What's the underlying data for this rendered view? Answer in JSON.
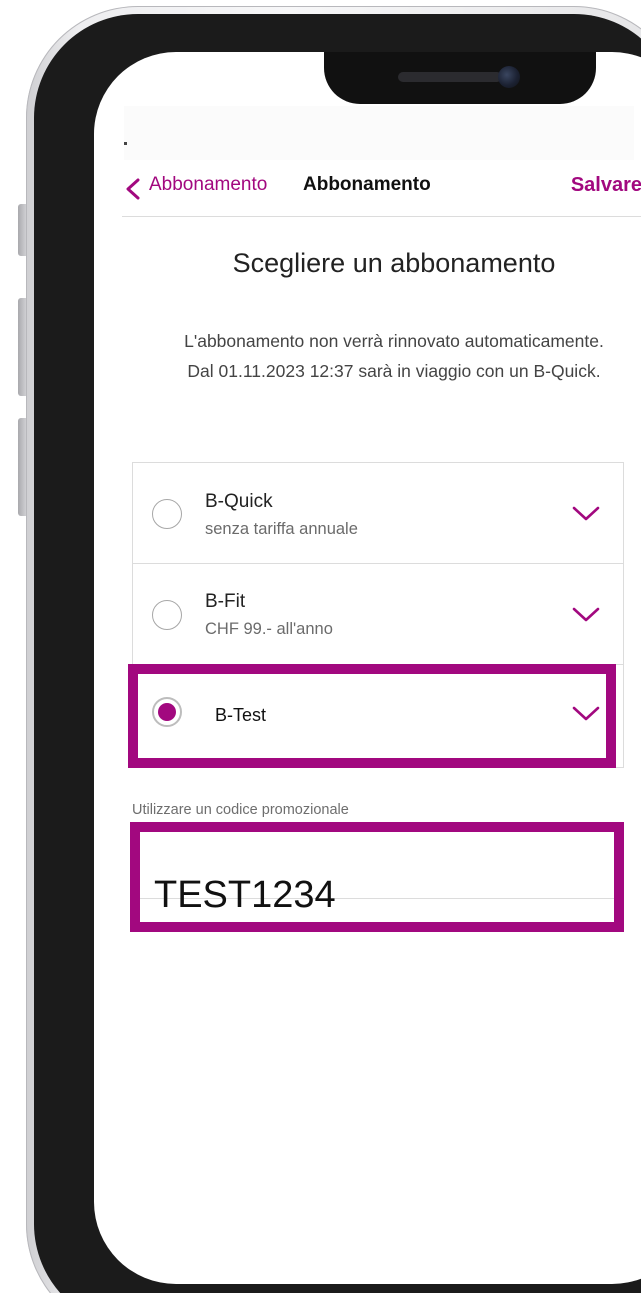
{
  "colors": {
    "accent": "#a2087f",
    "text_primary": "#222222",
    "text_secondary": "#6b6b6b",
    "divider": "#dcdcdc"
  },
  "nav": {
    "back_icon": "chevron-left-icon",
    "back_label": "Abbonamento",
    "title": "Abbonamento",
    "save_label": "Salvare"
  },
  "page": {
    "heading": "Scegliere un abbonamento",
    "info_line1": "L'abbonamento non verrà rinnovato automaticamente.",
    "info_line2": "Dal 01.11.2023 12:37 sarà in viaggio con un B-Quick."
  },
  "options": [
    {
      "title": "B-Quick",
      "subtitle": "senza tariffa annuale",
      "selected": false,
      "expand_icon": "chevron-down-icon"
    },
    {
      "title": "B-Fit",
      "subtitle": "CHF 99.- all'anno",
      "selected": false,
      "expand_icon": "chevron-down-icon"
    },
    {
      "title": "B-Test",
      "subtitle": "",
      "selected": true,
      "expand_icon": "chevron-down-icon"
    }
  ],
  "promo": {
    "label": "Utilizzare un codice promozionale",
    "value": "TEST1234"
  }
}
